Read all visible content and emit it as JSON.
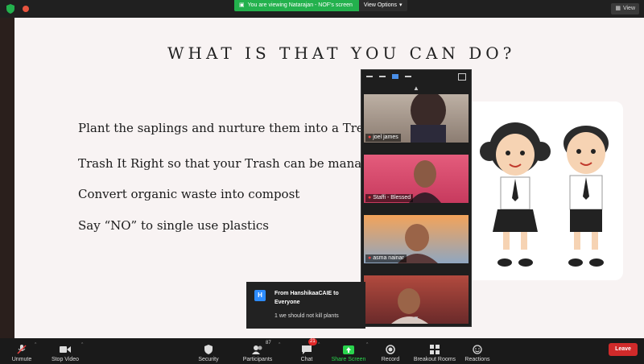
{
  "top_bar": {
    "viewing_text": "You are viewing Natarajan - NOF's screen",
    "view_options": "View Options",
    "view_button": "View"
  },
  "slide": {
    "title": "WHAT IS THAT YOU CAN DO?",
    "bullets": [
      "Plant the saplings and nurture them into a Tree",
      "Trash It Right so that your Trash can be manage",
      "Convert organic waste into compost",
      "Say “NO” to single use plastics"
    ]
  },
  "gallery": {
    "participants": [
      {
        "name": "joel james"
      },
      {
        "name": "Staffi - Blessed"
      },
      {
        "name": "asma nainar"
      },
      {
        "name": ""
      }
    ]
  },
  "chat_toast": {
    "avatar_letter": "H",
    "from": "From HanshikaaCAIE to Everyone",
    "message": "1 we should not kill plants"
  },
  "toolbar": {
    "unmute": "Unmute",
    "stop_video": "Stop Video",
    "security": "Security",
    "participants": "Participants",
    "participants_count": "87",
    "chat": "Chat",
    "chat_badge": "21",
    "share_screen": "Share Screen",
    "record": "Record",
    "breakout_rooms": "Breakout Rooms",
    "reactions": "Reactions",
    "leave": "Leave"
  },
  "colors": {
    "share_green": "#23b14d",
    "leave_red": "#d02a2a",
    "accent_blue": "#2d8cff"
  }
}
